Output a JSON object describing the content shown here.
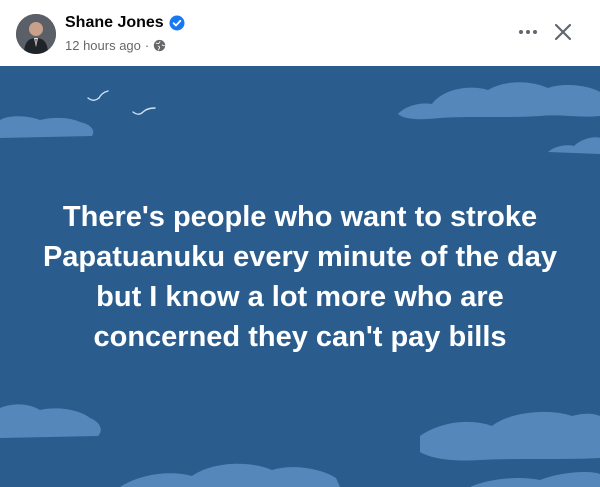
{
  "author": {
    "name": "Shane Jones",
    "verified": true,
    "avatar_icon": "avatar-photo"
  },
  "meta": {
    "time": "12 hours ago",
    "separator": "·",
    "audience_icon": "globe-icon"
  },
  "actions": {
    "more_icon": "more-dots-icon",
    "close_icon": "close-icon"
  },
  "post": {
    "lines": [
      "There's people who want to stroke",
      "Papatuanuku every minute of the day",
      "but I know a lot more who are",
      "concerned they can't pay bills"
    ],
    "background_color": "#2a5d8e",
    "cloud_color": "#5a8cc0"
  },
  "colors": {
    "verified_blue": "#1877f2",
    "meta_gray": "#65676b"
  }
}
